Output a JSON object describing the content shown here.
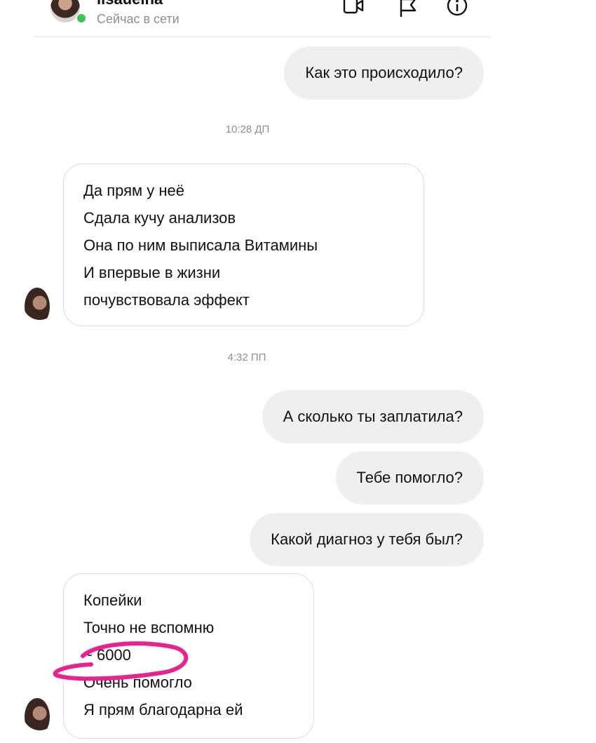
{
  "header": {
    "name": "lisaueina",
    "status": "Сейчас в сети",
    "icons": [
      "video-call-icon",
      "flag-icon",
      "info-icon"
    ]
  },
  "messages": {
    "out1": "Как это происходило?",
    "ts1": "10:28 ДП",
    "in1": [
      "Да прям у неё",
      "Сдала кучу анализов",
      "Она по ним выписала Витамины",
      "И впервые в жизни",
      "почувствовала эффект"
    ],
    "ts2": "4:32 ПП",
    "out2": "А сколько ты заплатила?",
    "out3": "Тебе помогло?",
    "out4": "Какой диагноз у тебя был?",
    "in2": [
      "Копейки",
      "Точно не вспомню",
      "~ 6000",
      "Очень помогло",
      "Я прям благодарна ей"
    ]
  },
  "colors": {
    "outgoing_bubble": "#efefef",
    "incoming_border": "#dbdbdb",
    "online": "#3ec35a",
    "highlight_marker": "#e8238f"
  }
}
